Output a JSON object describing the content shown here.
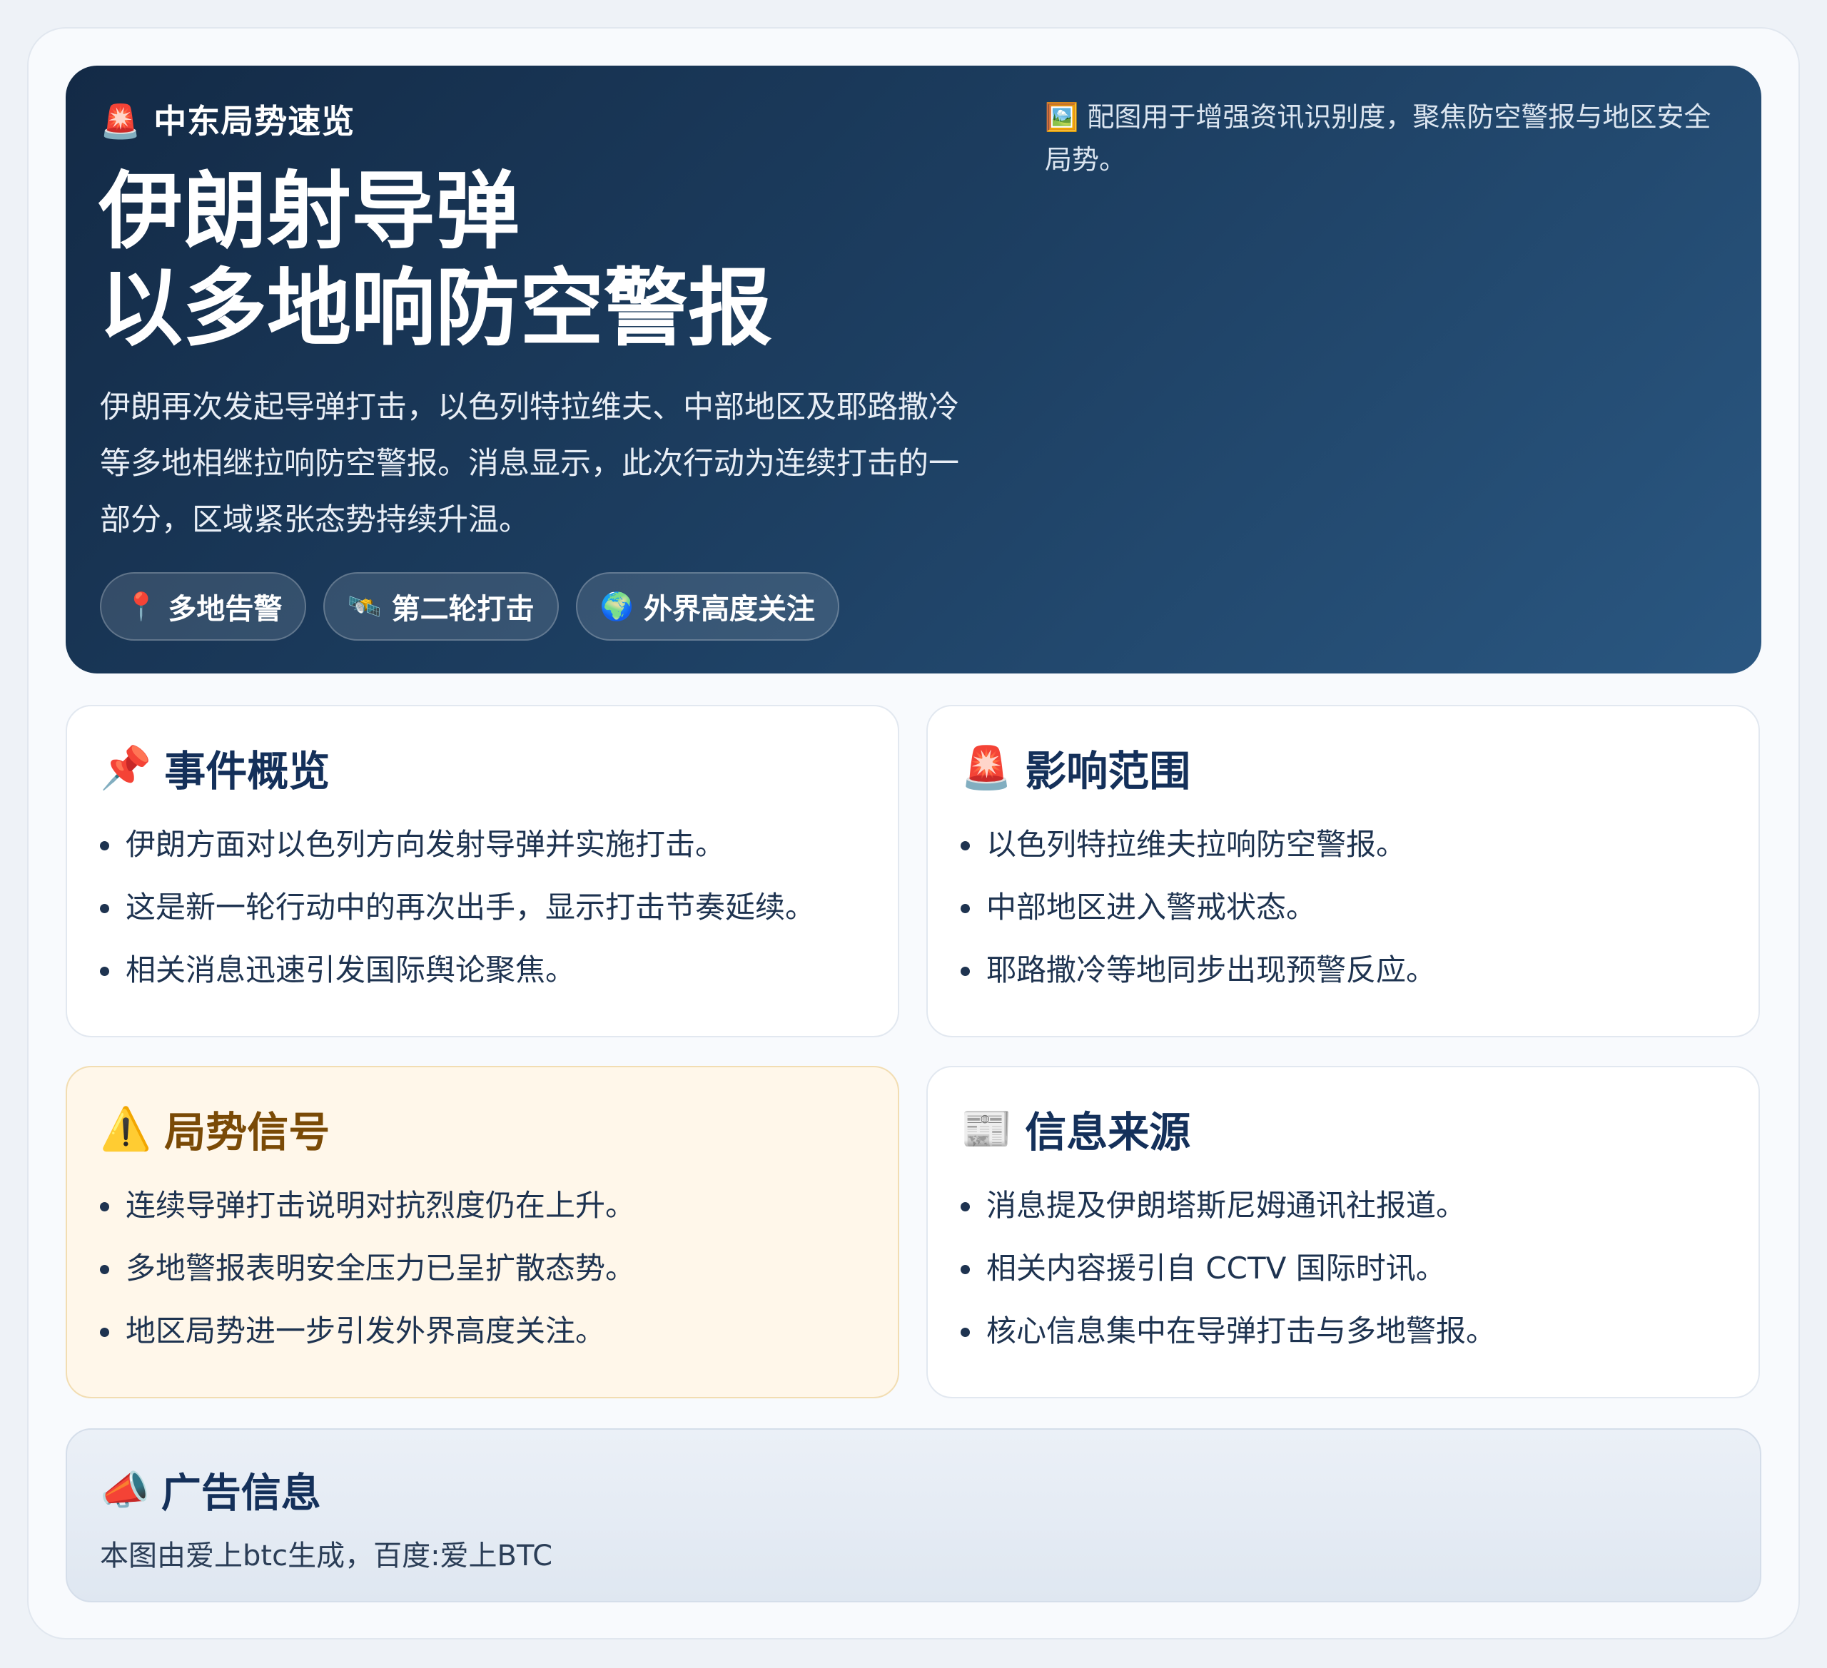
{
  "hero": {
    "tag_icon": "🚨",
    "tag": "中东局势速览",
    "title_line1": "伊朗射导弹",
    "title_line2": "以多地响防空警报",
    "description": "伊朗再次发起导弹打击，以色列特拉维夫、中部地区及耶路撒冷等多地相继拉响防空警报。消息显示，此次行动为连续打击的一部分，区域紧张态势持续升温。",
    "chips": [
      {
        "icon": "📍",
        "label": "多地告警"
      },
      {
        "icon": "🛰️",
        "label": "第二轮打击"
      },
      {
        "icon": "🌍",
        "label": "外界高度关注"
      }
    ],
    "note_icon": "🖼️",
    "note": "配图用于增强资讯识别度，聚焦防空警报与地区安全局势。"
  },
  "cards": [
    {
      "icon": "📌",
      "title": "事件概览",
      "items": [
        "伊朗方面对以色列方向发射导弹并实施打击。",
        "这是新一轮行动中的再次出手，显示打击节奏延续。",
        "相关消息迅速引发国际舆论聚焦。"
      ]
    },
    {
      "icon": "🚨",
      "title": "影响范围",
      "items": [
        "以色列特拉维夫拉响防空警报。",
        "中部地区进入警戒状态。",
        "耶路撒冷等地同步出现预警反应。"
      ]
    },
    {
      "icon": "⚠️",
      "title": "局势信号",
      "items": [
        "连续导弹打击说明对抗烈度仍在上升。",
        "多地警报表明安全压力已呈扩散态势。",
        "地区局势进一步引发外界高度关注。"
      ]
    },
    {
      "icon": "📰",
      "title": "信息来源",
      "items": [
        "消息提及伊朗塔斯尼姆通讯社报道。",
        "相关内容援引自 CCTV 国际时讯。",
        "核心信息集中在导弹打击与多地警报。"
      ]
    }
  ],
  "ad": {
    "icon": "📣",
    "title": "广告信息",
    "text": "本图由爱上btc生成，百度:爱上BTC"
  }
}
